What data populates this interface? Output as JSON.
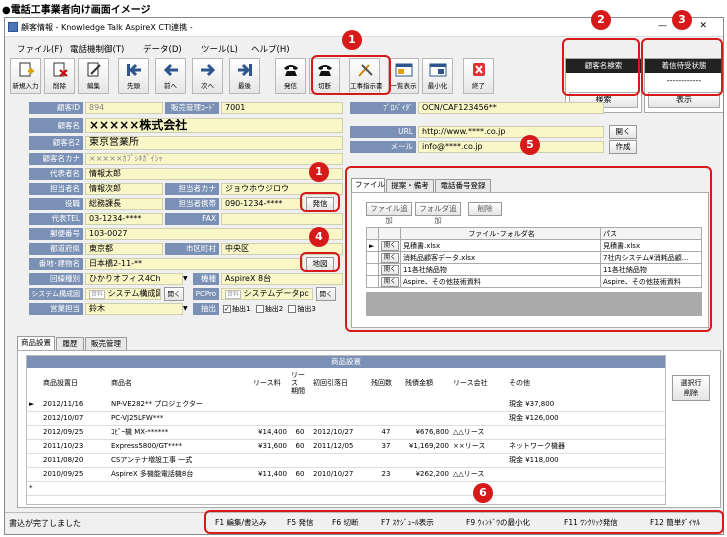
{
  "heading": "●電話工事業者向け画面イメージ",
  "window": {
    "title": "顧客情報 - Knowledge Talk  AspireX CTI連携 -"
  },
  "menu": [
    "ファイル(F)",
    "電話機制御(T)",
    "データ(D)",
    "ツール(L)",
    "ヘルプ(H)"
  ],
  "toolbar": [
    "新規入力",
    "削除",
    "編集",
    "先頭",
    "前へ",
    "次へ",
    "最後",
    "発信",
    "切断",
    "工事指示書",
    "一覧表示",
    "最小化",
    "終了"
  ],
  "panel_customer": {
    "title": "顧客名検索",
    "button": "検索"
  },
  "panel_incoming": {
    "title": "着信待受状態",
    "status": "------------",
    "button": "表示"
  },
  "form": {
    "id_label": "顧客ID",
    "id_value": "894",
    "store_label": "販売管理ｺｰﾄﾞ",
    "store_value": "7001",
    "name_label": "顧客名",
    "name_value": "×××××株式会社",
    "name2_label": "顧客名2",
    "name2_value": "東京営業所",
    "kana_label": "顧客名カナ",
    "kana_value": "×××××ｶﾌﾞｼｷｶﾞｲｼｬ",
    "rep_label": "代表者名",
    "rep_value": "情報太郎",
    "contact_label": "担当者名",
    "contact_value": "情報次郎",
    "contact_kana_label": "担当者カナ",
    "contact_kana_value": "ジョウホウジロウ",
    "role_label": "役職",
    "role_value": "総務課長",
    "mobile_label": "担当者携帯",
    "mobile_value": "090-1234-****",
    "call_button": "発信",
    "tel_label": "代表TEL",
    "tel_value": "03-1234-****",
    "fax_label": "FAX",
    "fax_value": "",
    "zip_label": "郵便番号",
    "zip_value": "103-0027",
    "pref_label": "都道府県",
    "pref_value": "東京都",
    "city_label": "市区町村",
    "city_value": "中央区",
    "addr_label": "番地･建物名",
    "addr_value": "日本橋2-11-**",
    "map_button": "地図",
    "line_label": "回線種別",
    "line_value": "ひかりオフィス4Ch",
    "model_label": "機種",
    "model_value": "AspireX  8台",
    "system_label": "システム構成図",
    "system_tag": "資料",
    "system_value": "システム構成図",
    "open_button": "開く",
    "pcpro_label": "PCPro",
    "pcpro_tag": "資料",
    "pcpro_value": "システムデータpc",
    "sales_label": "営業担当",
    "sales_value": "鈴木",
    "extract_label": "抽出",
    "extract1": "抽出1",
    "extract2": "抽出2",
    "extract3": "抽出3",
    "provider_label": "ﾌﾟﾛﾊﾞｲﾀﾞ",
    "provider_value": "OCN/CAF123456**",
    "url_label": "URL",
    "url_value": "http://www.****.co.jp",
    "url_button": "開く",
    "mail_label": "メール",
    "mail_value": "info@****.co.jp",
    "mail_button": "作成"
  },
  "file_panel": {
    "tabs": [
      "ファイル",
      "提案・備考",
      "電話番号登録"
    ],
    "buttons": [
      "ファイル追加",
      "フォルダ追加",
      "削除"
    ],
    "col_name": "ファイル･フォルダ名",
    "col_path": "パス",
    "open_label": "開く",
    "rows": [
      {
        "name": "見積書.xlsx",
        "path": "見積書.xlsx"
      },
      {
        "name": "消耗品顧客データ.xlsx",
        "path": "7社内システム¥消耗品顧..."
      },
      {
        "name": "11各社納品物",
        "path": "11各社納品物"
      },
      {
        "name": "Aspire、その他技術資料",
        "path": "Aspire、その他技術資料"
      }
    ]
  },
  "bottom_tabs": [
    "商品設置",
    "履歴",
    "販売管理"
  ],
  "products": {
    "title": "商品設置",
    "delete_button": "選択行\n削除",
    "headers": [
      "商品設置日",
      "商品名",
      "リース料",
      "リース\n期間",
      "初回引落日",
      "残回数",
      "残債金額",
      "リース会社",
      "その他"
    ],
    "rows": [
      [
        "2012/11/16",
        "NP-VE282** プロジェクター",
        "",
        "",
        "",
        "",
        "",
        "",
        "現金  ¥37,800"
      ],
      [
        "2012/10/07",
        "PC-VJ25LFW***",
        "",
        "",
        "",
        "",
        "",
        "",
        "現金  ¥126,000"
      ],
      [
        "2012/09/25",
        "ｺﾋﾟｰ機  MX-******",
        "¥14,400",
        "60",
        "2012/10/27",
        "47",
        "¥676,800",
        "△△リース",
        ""
      ],
      [
        "2011/10/23",
        "Express5800/GT****",
        "¥31,600",
        "60",
        "2011/12/05",
        "37",
        "¥1,169,200",
        "××リース",
        "ネットワーク機器"
      ],
      [
        "2011/08/20",
        "CSアンテナ増設工事 一式",
        "",
        "",
        "",
        "",
        "",
        "",
        "現金  ¥118,000"
      ],
      [
        "2010/09/25",
        "AspireX 多機能電話機8台",
        "¥11,400",
        "60",
        "2010/10/27",
        "23",
        "¥262,200",
        "△△リース",
        ""
      ]
    ]
  },
  "status": {
    "text": "書込が完了しました",
    "fkeys": [
      "F1 編集/書込み",
      "F5 発信",
      "F6 切断",
      "F7 ｽｹｼﾞｭｰﾙ表示",
      "F9 ｳｨﾝﾄﾞｳの最小化",
      "F11 ﾜﾝｸﾘｯｸ発信",
      "F12 簡単ﾀﾞｲﾔﾙ"
    ]
  },
  "callouts": [
    "1",
    "2",
    "3",
    "1",
    "4",
    "5",
    "6"
  ],
  "colors": {
    "label_bg": "#7a90b4",
    "value_bg": "#f9f7c8",
    "callout": "#d61a1a"
  }
}
